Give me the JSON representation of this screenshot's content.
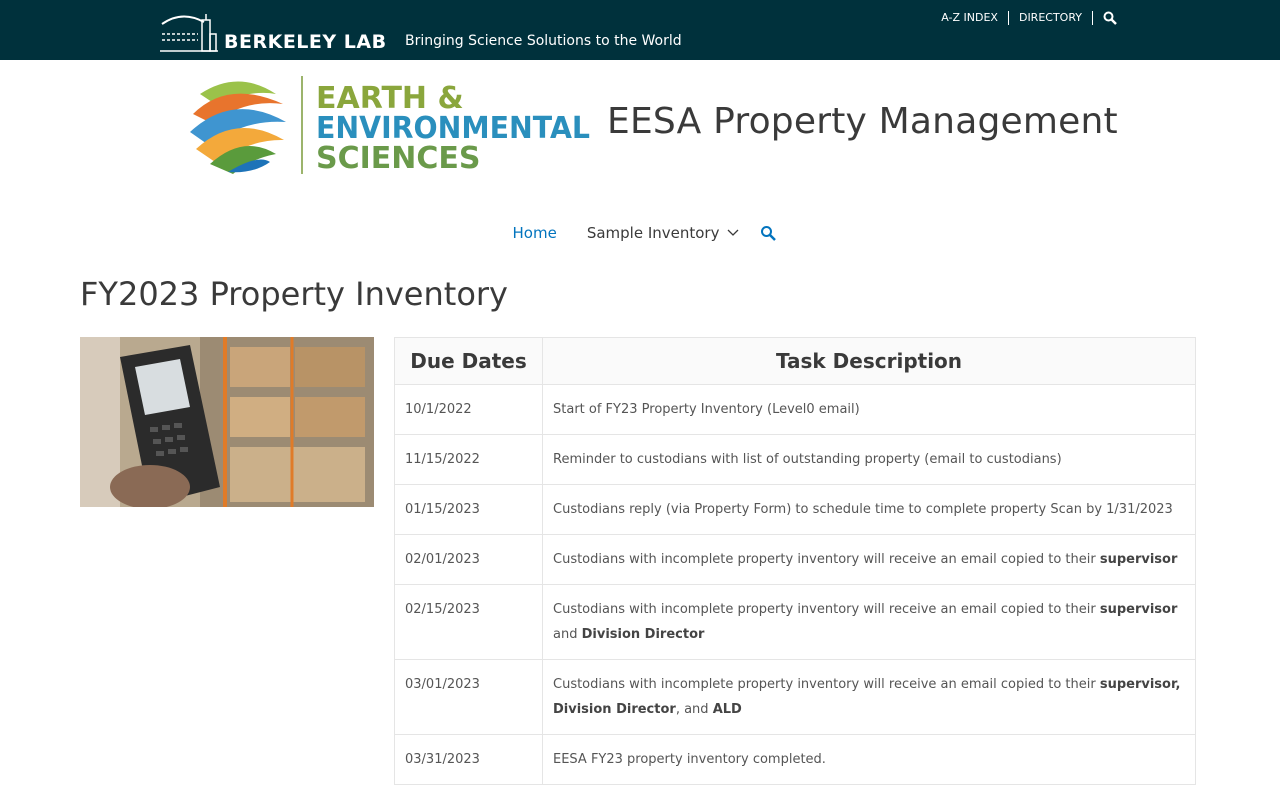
{
  "header": {
    "lab_name": "BERKELEY LAB",
    "tagline": "Bringing Science Solutions to the World",
    "util_links": [
      "A-Z INDEX",
      "DIRECTORY"
    ]
  },
  "branding": {
    "logo_line1": "EARTH &",
    "logo_line2": "ENVIRONMENTAL",
    "logo_line3": "SCIENCES",
    "site_title": "EESA Property Management"
  },
  "nav": {
    "home": "Home",
    "sample_inventory": "Sample Inventory"
  },
  "page": {
    "title": "FY2023 Property Inventory"
  },
  "table": {
    "headers": [
      "Due Dates",
      "Task Description"
    ],
    "rows": [
      {
        "date": "10/1/2022",
        "desc": "Start of FY23 Property Inventory (Level0 email)"
      },
      {
        "date": "11/15/2022",
        "desc": "Reminder to custodians with list of outstanding property (email to custodians)"
      },
      {
        "date": "01/15/2023",
        "desc": "Custodians reply (via Property Form) to schedule time to complete property Scan by 1/31/2023"
      },
      {
        "date": "02/01/2023",
        "desc": "Custodians with incomplete property inventory will receive an email copied to their ",
        "bold1": "supervisor"
      },
      {
        "date": "02/15/2023",
        "desc": "Custodians with incomplete property inventory will receive an email copied to their ",
        "bold1": "supervisor",
        "mid": " and ",
        "bold2": "Division Director"
      },
      {
        "date": "03/01/2023",
        "desc": "Custodians with incomplete property inventory will receive an email copied to their ",
        "bold1": "supervisor, Division Director",
        "mid": ", and ",
        "bold2": "ALD"
      },
      {
        "date": "03/31/2023",
        "desc": "EESA FY23 property inventory completed."
      }
    ]
  },
  "colors": {
    "topbar": "#00313c",
    "link_active": "#0274be",
    "text": "#3a3a3a"
  }
}
